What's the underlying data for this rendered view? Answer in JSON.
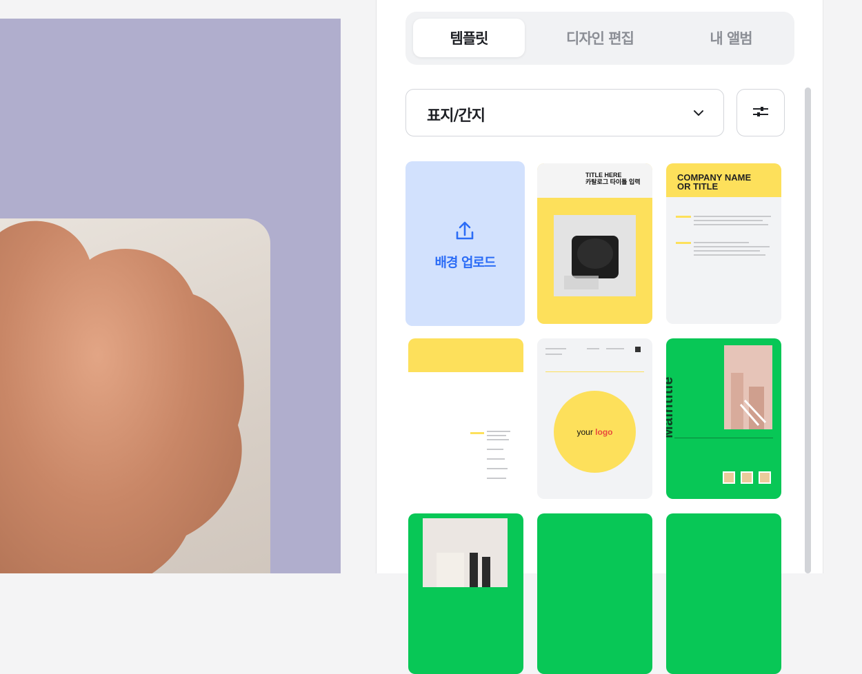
{
  "tabs": [
    {
      "label": "템플릿",
      "active": true
    },
    {
      "label": "디자인 편집",
      "active": false
    },
    {
      "label": "내 앨범",
      "active": false
    }
  ],
  "category_select": {
    "value": "표지/간지"
  },
  "upload_card": {
    "label": "배경 업로드",
    "icon": "upload-icon"
  },
  "templates": {
    "t1": {
      "heading_line1": "TITLE HERE",
      "heading_line2": "카탈로그 타이틀 입력"
    },
    "t2": {
      "heading_line1": "COMPANY NAME",
      "heading_line2": "OR TITLE"
    },
    "t4": {
      "logo_your": "your",
      "logo_word": "logo"
    },
    "t5": {
      "main_title": "Maintitle"
    }
  },
  "colors": {
    "accent_blue": "#2b6cf6",
    "upload_bg": "#d2e1fd",
    "yellow": "#fde05b",
    "green": "#08c756",
    "canvas_bg": "#b0aecd"
  }
}
